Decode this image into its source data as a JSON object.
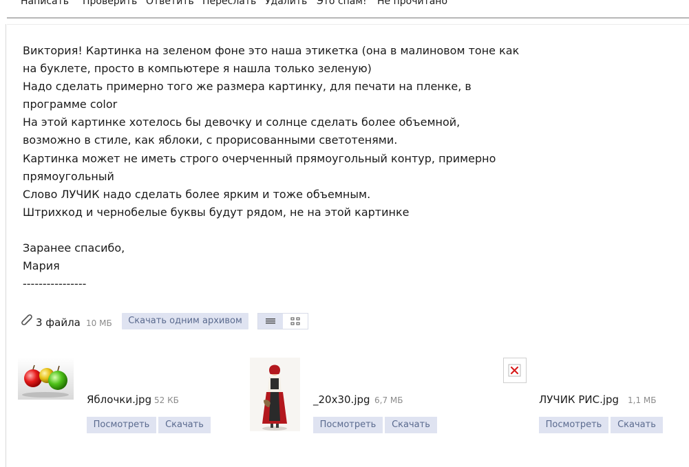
{
  "toolbar": {
    "compose": "Написать",
    "check": "Проверить",
    "reply": "Ответить",
    "forward": "Переслать",
    "delete": "Удалить",
    "spam": "Это спам!",
    "unread": "Не прочитано"
  },
  "message": {
    "lines": [
      "Виктория! Картинка на зеленом фоне это наша этикетка (она в малиновом тоне как",
      "на буклете, просто в компьютере я нашла только зеленую)",
      "Надо сделать примерно того же размера картинку, для печати на пленке, в",
      "программе color",
      "На этой картинке хотелось бы девочку и солнце  сделать более объемной,",
      "возможно в стиле, как яблоки, с прорисованными светотенями.",
      "Картинка может не иметь строго очерченный прямоугольный контур, примерно",
      "прямоугольный",
      "Слово ЛУЧИК надо сделать более ярким и тоже объемным.",
      "Штрихкод и чернобелые буквы будут рядом, не на этой картинке",
      "",
      "Заранее спасибо,",
      "Мария",
      "----------------"
    ]
  },
  "attachments": {
    "count_label": "3 файла",
    "total_size": "10 МБ",
    "archive_button": "Скачать одним архивом",
    "view_icons": [
      "list-view-icon",
      "grid-view-icon"
    ],
    "files": [
      {
        "name": "Яблочки.jpg",
        "size": "52 КБ",
        "view": "Посмотреть",
        "download": "Скачать",
        "thumb": "apples"
      },
      {
        "name": "_20x30.jpg",
        "size": "6,7 МБ",
        "view": "Посмотреть",
        "download": "Скачать",
        "thumb": "girl"
      },
      {
        "name": "ЛУЧИК РИС.jpg",
        "size": "1,1 МБ",
        "view": "Посмотреть",
        "download": "Скачать",
        "thumb": "broken-image-icon"
      }
    ]
  },
  "colors": {
    "button_bg": "#dfe3f1",
    "button_text": "#5a6a8e",
    "muted_text": "#8a8a8a",
    "toolbar_line": "#b7b7b7"
  }
}
